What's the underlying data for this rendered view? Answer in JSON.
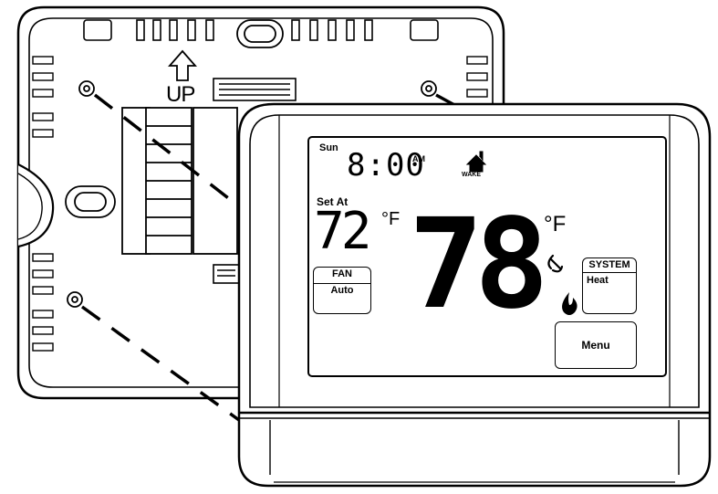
{
  "backplate": {
    "up_label": "UP"
  },
  "display": {
    "day": "Sun",
    "time": "8:00",
    "ampm": "AM",
    "period": "WAKE",
    "set_at_label": "Set At",
    "setpoint": "72",
    "setpoint_unit": "°F",
    "current_temp": "78",
    "current_unit": "°F",
    "fan": {
      "title": "FAN",
      "value": "Auto"
    },
    "system": {
      "title": "SYSTEM",
      "value": "Heat"
    },
    "menu_label": "Menu"
  },
  "icons": {
    "up_arrow": "up-arrow-icon",
    "home": "home-icon",
    "fan": "fan-icon",
    "flame": "flame-icon"
  }
}
